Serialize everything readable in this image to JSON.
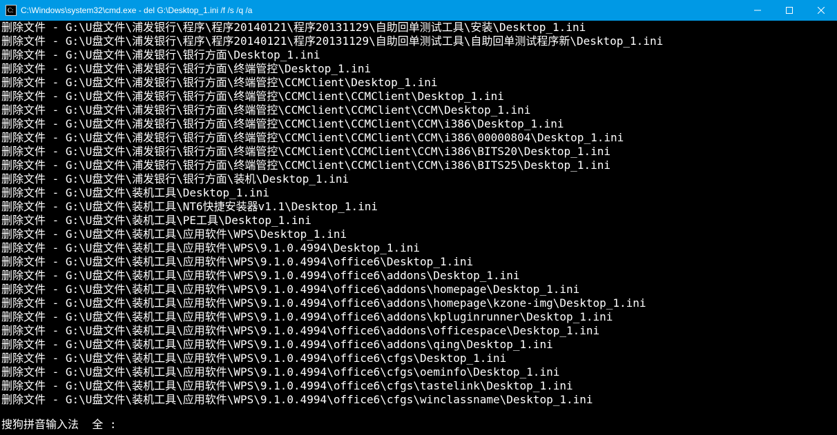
{
  "titlebar": {
    "title": "C:\\Windows\\system32\\cmd.exe - del  G:\\Desktop_1.ini /f /s /q /a"
  },
  "controls": {
    "minimize": "minimize",
    "maximize": "maximize",
    "close": "close"
  },
  "console": {
    "prefix": "删除文件 - ",
    "lines": [
      "G:\\U盘文件\\浦发银行\\程序\\程序20140121\\程序20131129\\自助回单测试工具\\安装\\Desktop_1.ini",
      "G:\\U盘文件\\浦发银行\\程序\\程序20140121\\程序20131129\\自助回单测试工具\\自助回单测试程序新\\Desktop_1.ini",
      "G:\\U盘文件\\浦发银行\\银行方面\\Desktop_1.ini",
      "G:\\U盘文件\\浦发银行\\银行方面\\终端管控\\Desktop_1.ini",
      "G:\\U盘文件\\浦发银行\\银行方面\\终端管控\\CCMClient\\Desktop_1.ini",
      "G:\\U盘文件\\浦发银行\\银行方面\\终端管控\\CCMClient\\CCMClient\\Desktop_1.ini",
      "G:\\U盘文件\\浦发银行\\银行方面\\终端管控\\CCMClient\\CCMClient\\CCM\\Desktop_1.ini",
      "G:\\U盘文件\\浦发银行\\银行方面\\终端管控\\CCMClient\\CCMClient\\CCM\\i386\\Desktop_1.ini",
      "G:\\U盘文件\\浦发银行\\银行方面\\终端管控\\CCMClient\\CCMClient\\CCM\\i386\\00000804\\Desktop_1.ini",
      "G:\\U盘文件\\浦发银行\\银行方面\\终端管控\\CCMClient\\CCMClient\\CCM\\i386\\BITS20\\Desktop_1.ini",
      "G:\\U盘文件\\浦发银行\\银行方面\\终端管控\\CCMClient\\CCMClient\\CCM\\i386\\BITS25\\Desktop_1.ini",
      "G:\\U盘文件\\浦发银行\\银行方面\\装机\\Desktop_1.ini",
      "G:\\U盘文件\\装机工具\\Desktop_1.ini",
      "G:\\U盘文件\\装机工具\\NT6快捷安装器v1.1\\Desktop_1.ini",
      "G:\\U盘文件\\装机工具\\PE工具\\Desktop_1.ini",
      "G:\\U盘文件\\装机工具\\应用软件\\WPS\\Desktop_1.ini",
      "G:\\U盘文件\\装机工具\\应用软件\\WPS\\9.1.0.4994\\Desktop_1.ini",
      "G:\\U盘文件\\装机工具\\应用软件\\WPS\\9.1.0.4994\\office6\\Desktop_1.ini",
      "G:\\U盘文件\\装机工具\\应用软件\\WPS\\9.1.0.4994\\office6\\addons\\Desktop_1.ini",
      "G:\\U盘文件\\装机工具\\应用软件\\WPS\\9.1.0.4994\\office6\\addons\\homepage\\Desktop_1.ini",
      "G:\\U盘文件\\装机工具\\应用软件\\WPS\\9.1.0.4994\\office6\\addons\\homepage\\kzone-img\\Desktop_1.ini",
      "G:\\U盘文件\\装机工具\\应用软件\\WPS\\9.1.0.4994\\office6\\addons\\kpluginrunner\\Desktop_1.ini",
      "G:\\U盘文件\\装机工具\\应用软件\\WPS\\9.1.0.4994\\office6\\addons\\officespace\\Desktop_1.ini",
      "G:\\U盘文件\\装机工具\\应用软件\\WPS\\9.1.0.4994\\office6\\addons\\qing\\Desktop_1.ini",
      "G:\\U盘文件\\装机工具\\应用软件\\WPS\\9.1.0.4994\\office6\\cfgs\\Desktop_1.ini",
      "G:\\U盘文件\\装机工具\\应用软件\\WPS\\9.1.0.4994\\office6\\cfgs\\oeminfo\\Desktop_1.ini",
      "G:\\U盘文件\\装机工具\\应用软件\\WPS\\9.1.0.4994\\office6\\cfgs\\tastelink\\Desktop_1.ini",
      "G:\\U盘文件\\装机工具\\应用软件\\WPS\\9.1.0.4994\\office6\\cfgs\\winclassname\\Desktop_1.ini"
    ],
    "ime": "搜狗拼音输入法  全 :"
  }
}
